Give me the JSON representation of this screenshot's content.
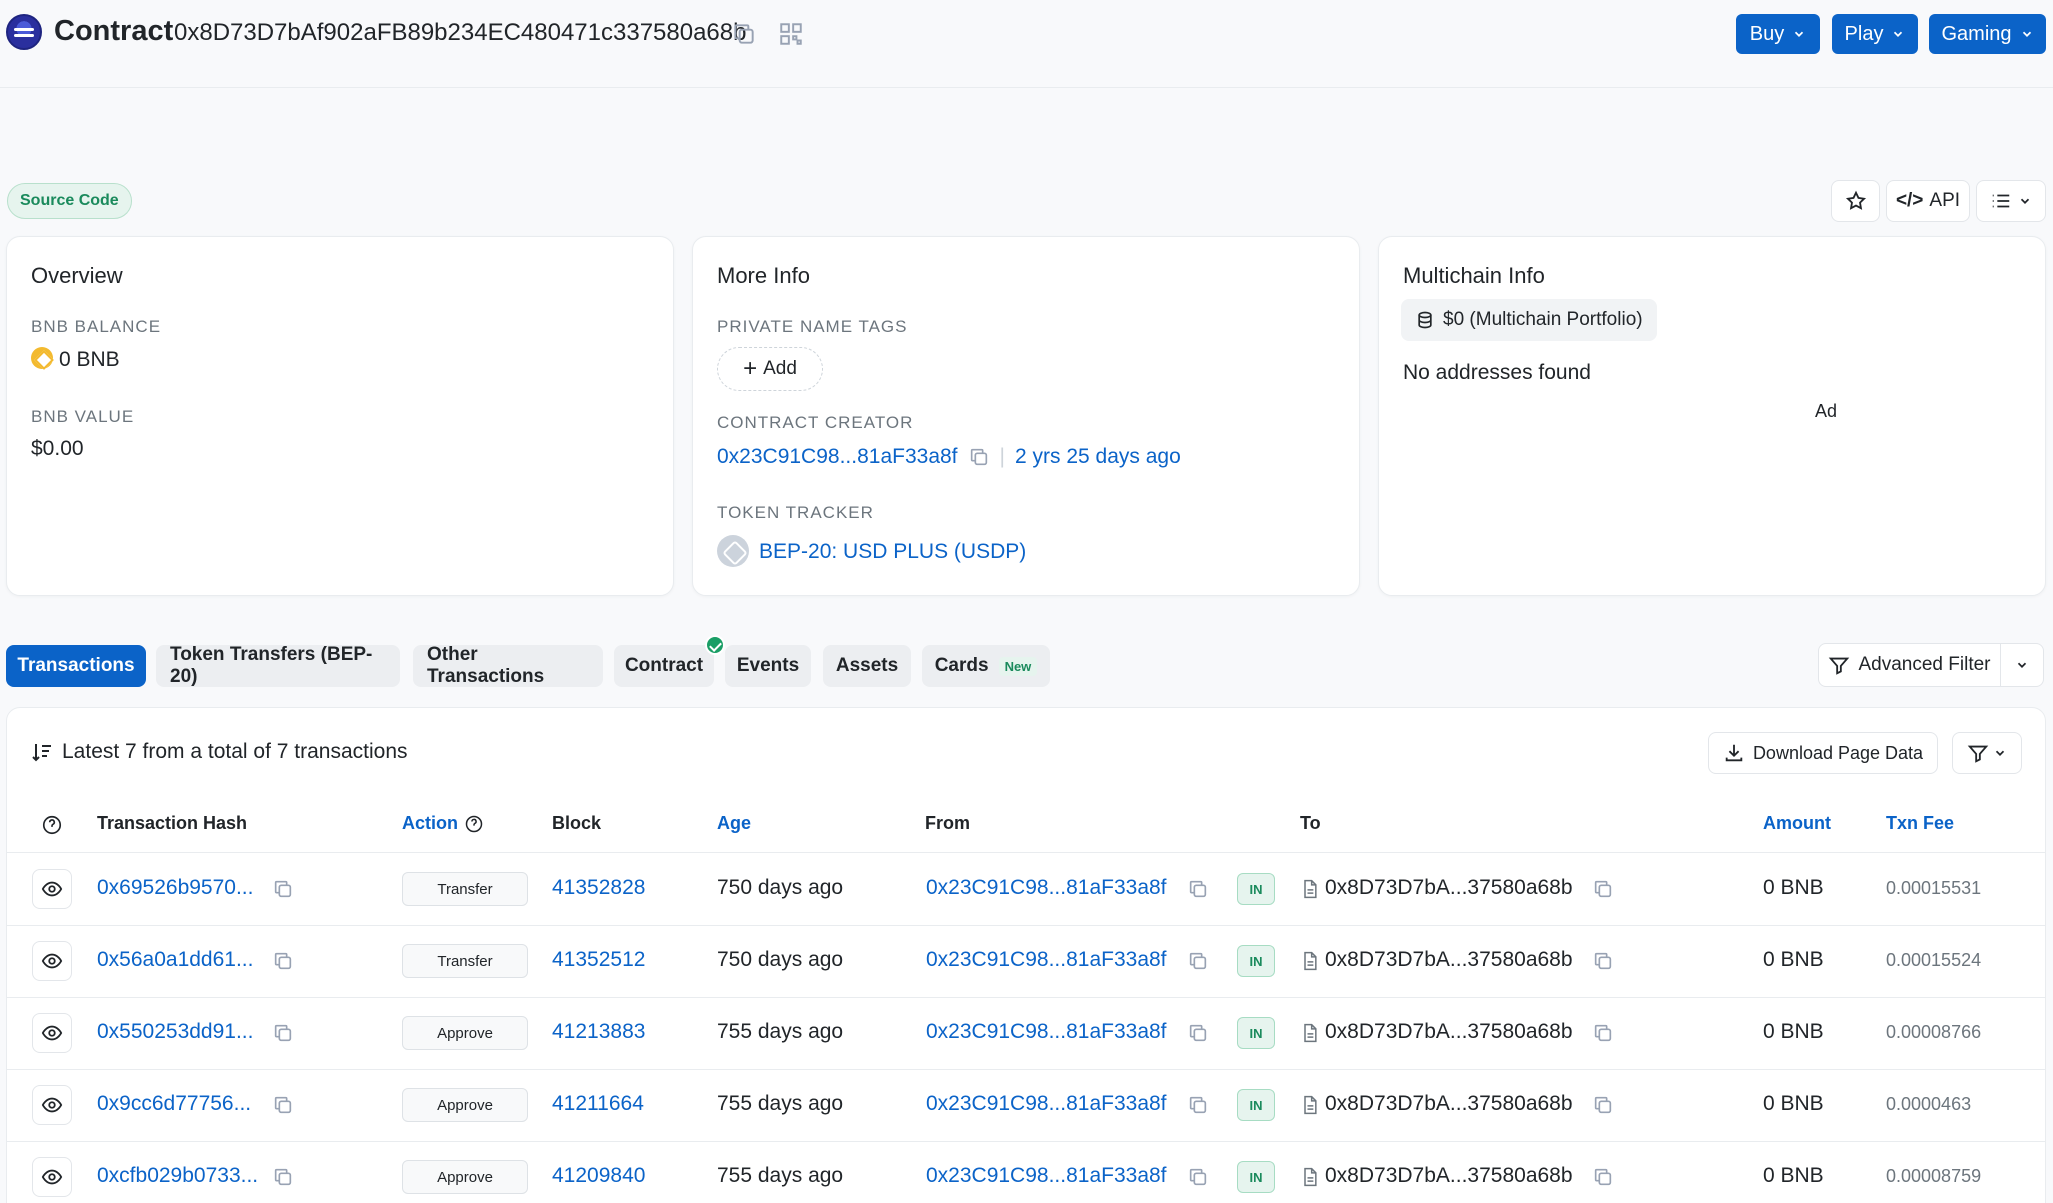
{
  "header": {
    "title": "Contract",
    "address": "0x8D73D7bAf902aFB89b234EC480471c337580a68b",
    "buttons": [
      {
        "label": "Buy"
      },
      {
        "label": "Play"
      },
      {
        "label": "Gaming"
      }
    ]
  },
  "source_badge": "Source Code",
  "toolbar": {
    "api_label": "API"
  },
  "overview": {
    "title": "Overview",
    "balance_label": "BNB BALANCE",
    "balance_value": "0 BNB",
    "value_label": "BNB VALUE",
    "value_value": "$0.00"
  },
  "more_info": {
    "title": "More Info",
    "tags_label": "PRIVATE NAME TAGS",
    "add_label": "Add",
    "creator_label": "CONTRACT CREATOR",
    "creator_address": "0x23C91C98...81aF33a8f",
    "creator_age": "2 yrs 25 days ago",
    "tracker_label": "TOKEN TRACKER",
    "tracker_value": "BEP-20: USD PLUS (USDP)"
  },
  "multichain": {
    "title": "Multichain Info",
    "portfolio": "$0 (Multichain Portfolio)",
    "no_addresses": "No addresses found",
    "ad_label": "Ad"
  },
  "tabs": [
    {
      "label": "Transactions"
    },
    {
      "label": "Token Transfers (BEP-20)"
    },
    {
      "label": "Other Transactions"
    },
    {
      "label": "Contract"
    },
    {
      "label": "Events"
    },
    {
      "label": "Assets"
    },
    {
      "label": "Cards",
      "badge": "New"
    }
  ],
  "advanced_filter": "Advanced Filter",
  "table": {
    "summary": "Latest 7 from a total of 7 transactions",
    "download_label": "Download Page Data",
    "headers": {
      "hash": "Transaction Hash",
      "action": "Action",
      "block": "Block",
      "age": "Age",
      "from": "From",
      "to": "To",
      "amount": "Amount",
      "fee": "Txn Fee"
    },
    "rows": [
      {
        "hash": "0x69526b9570...",
        "action": "Transfer",
        "block": "41352828",
        "age": "750 days ago",
        "from": "0x23C91C98...81aF33a8f",
        "dir": "IN",
        "to": "0x8D73D7bA...37580a68b",
        "amount": "0 BNB",
        "fee": "0.00015531"
      },
      {
        "hash": "0x56a0a1dd61...",
        "action": "Transfer",
        "block": "41352512",
        "age": "750 days ago",
        "from": "0x23C91C98...81aF33a8f",
        "dir": "IN",
        "to": "0x8D73D7bA...37580a68b",
        "amount": "0 BNB",
        "fee": "0.00015524"
      },
      {
        "hash": "0x550253dd91...",
        "action": "Approve",
        "block": "41213883",
        "age": "755 days ago",
        "from": "0x23C91C98...81aF33a8f",
        "dir": "IN",
        "to": "0x8D73D7bA...37580a68b",
        "amount": "0 BNB",
        "fee": "0.00008766"
      },
      {
        "hash": "0x9cc6d77756...",
        "action": "Approve",
        "block": "41211664",
        "age": "755 days ago",
        "from": "0x23C91C98...81aF33a8f",
        "dir": "IN",
        "to": "0x8D73D7bA...37580a68b",
        "amount": "0 BNB",
        "fee": "0.0000463"
      },
      {
        "hash": "0xcfb029b0733...",
        "action": "Approve",
        "block": "41209840",
        "age": "755 days ago",
        "from": "0x23C91C98...81aF33a8f",
        "dir": "IN",
        "to": "0x8D73D7bA...37580a68b",
        "amount": "0 BNB",
        "fee": "0.00008759"
      }
    ]
  },
  "colors": {
    "accent": "#0b63c8",
    "success": "#1a8a5c",
    "muted": "#6c757d"
  }
}
